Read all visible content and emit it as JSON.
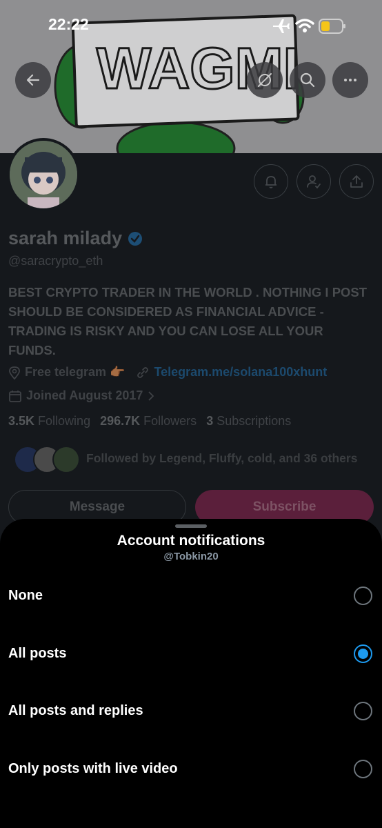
{
  "status_bar": {
    "time": "22:22"
  },
  "banner": {
    "text": "WAGMI"
  },
  "profile": {
    "name": "sarah milady",
    "handle": "@saracrypto_eth",
    "bio": "BEST CRYPTO TRADER IN THE WORLD . NOTHING I POST SHOULD BE CONSIDERED AS FINANCIAL ADVICE - TRADING IS RISKY AND YOU CAN LOSE ALL YOUR FUNDS.",
    "location": "Free telegram 👉🏾",
    "website": "Telegram.me/solana100xhunt",
    "joined": "Joined August 2017",
    "following_count": "3.5K",
    "following_label": "Following",
    "followers_count": "296.7K",
    "followers_label": "Followers",
    "subscriptions_count": "3",
    "subscriptions_label": "Subscriptions",
    "followed_by": "Followed by Legend, Fluffy, cold, and 36 others",
    "message_label": "Message",
    "subscribe_label": "Subscribe"
  },
  "sheet": {
    "title": "Account notifications",
    "subtitle": "@Tobkin20",
    "options": [
      {
        "label": "None",
        "selected": false
      },
      {
        "label": "All posts",
        "selected": true
      },
      {
        "label": "All posts and replies",
        "selected": false
      },
      {
        "label": "Only posts with live video",
        "selected": false
      }
    ]
  },
  "colors": {
    "accent": "#1d9bf0",
    "subscribe": "#5b1f3b",
    "verified": "#1d9bf0"
  },
  "icons": [
    "back-arrow-icon",
    "no-translate-icon",
    "search-icon",
    "more-icon",
    "notification-bell-icon",
    "following-user-icon",
    "share-icon",
    "verified-badge-icon",
    "location-icon",
    "link-icon",
    "calendar-icon",
    "chevron-right-icon",
    "airplane-icon",
    "wifi-icon",
    "battery-icon"
  ]
}
